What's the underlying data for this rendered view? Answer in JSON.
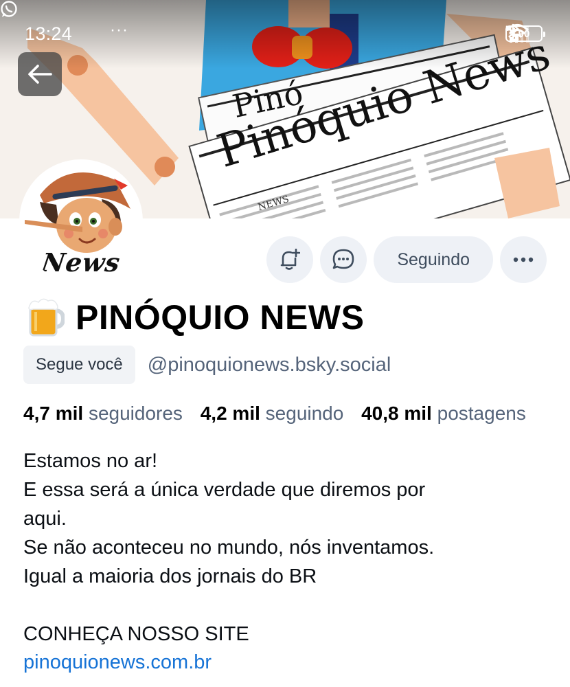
{
  "status_bar": {
    "time": "13:24",
    "notification_icons": [
      "whatsapp-icon",
      "more-dots"
    ],
    "network": "5G",
    "battery_level": "90"
  },
  "banner": {
    "newspaper_headline": "Pinóquio News",
    "newspaper_headline_back": "Pinó",
    "newspaper_section": "NEWS"
  },
  "avatar": {
    "logo_text": "News"
  },
  "actions": {
    "following_label": "Seguindo"
  },
  "profile": {
    "display_name": "PINÓQUIO NEWS",
    "name_emoji": "beer-mug-icon",
    "follows_you": "Segue você",
    "handle": "@pinoquionews.bsky.social"
  },
  "stats": [
    {
      "value": "4,7 mil",
      "label": "seguidores"
    },
    {
      "value": "4,2 mil",
      "label": "seguindo"
    },
    {
      "value": "40,8 mil",
      "label": "postagens"
    }
  ],
  "bio": {
    "lines": [
      "Estamos no ar!",
      "E essa será a única verdade que diremos por",
      "aqui.",
      "Se não aconteceu no mundo, nós inventamos.",
      "Igual a maioria dos jornais do BR",
      "",
      "CONHEÇA NOSSO SITE"
    ],
    "link": "pinoquionews.com.br"
  },
  "colors": {
    "accent_link": "#1673d6",
    "muted_text": "#55647a",
    "button_bg": "#eef1f6"
  }
}
